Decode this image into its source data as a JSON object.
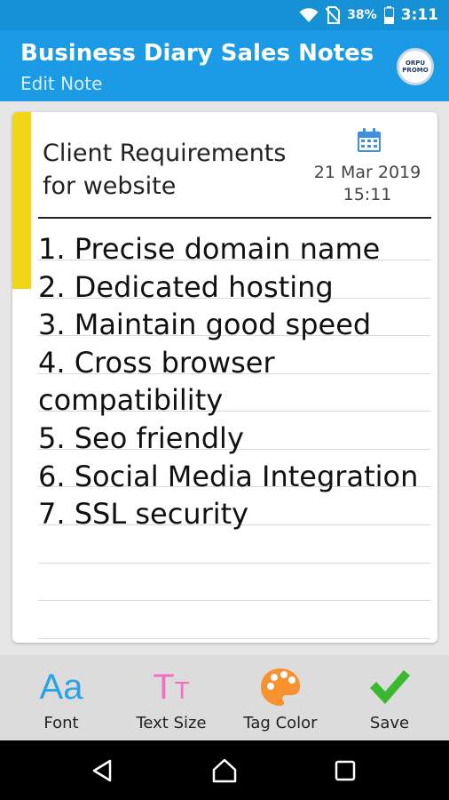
{
  "status_bar": {
    "battery_percent": "38%",
    "time": "3:11",
    "icons": [
      "wifi-icon",
      "no-sim-icon",
      "battery-icon"
    ]
  },
  "app_bar": {
    "title": "Business Diary Sales Notes R...",
    "subtitle": "Edit Note",
    "promo_badge": "ORPU PROMO"
  },
  "note": {
    "title_line1": "Client Requirements",
    "title_line2": "for website",
    "date": "21 Mar 2019",
    "time": "15:11",
    "tag_color": "#f2d515",
    "lines": [
      "1. Precise domain name",
      "2. Dedicated hosting",
      "3. Maintain good speed",
      "4. Cross browser",
      "compatibility",
      "5. Seo friendly",
      "6. Social Media Integration",
      "7. SSL security"
    ]
  },
  "toolbar": {
    "font_icon_text": "Aa",
    "font_label": "Font",
    "text_size_icon_big": "T",
    "text_size_icon_small": "T",
    "text_size_label": "Text Size",
    "tag_color_label": "Tag Color",
    "save_label": "Save"
  },
  "colors": {
    "status_bar": "#1691d6",
    "app_bar": "#1b9be5",
    "tag": "#f2d515",
    "font_icon": "#29a3e6",
    "text_size_icon": "#f06fc5",
    "palette_icon": "#f7922f",
    "save_icon": "#3bb82f"
  }
}
